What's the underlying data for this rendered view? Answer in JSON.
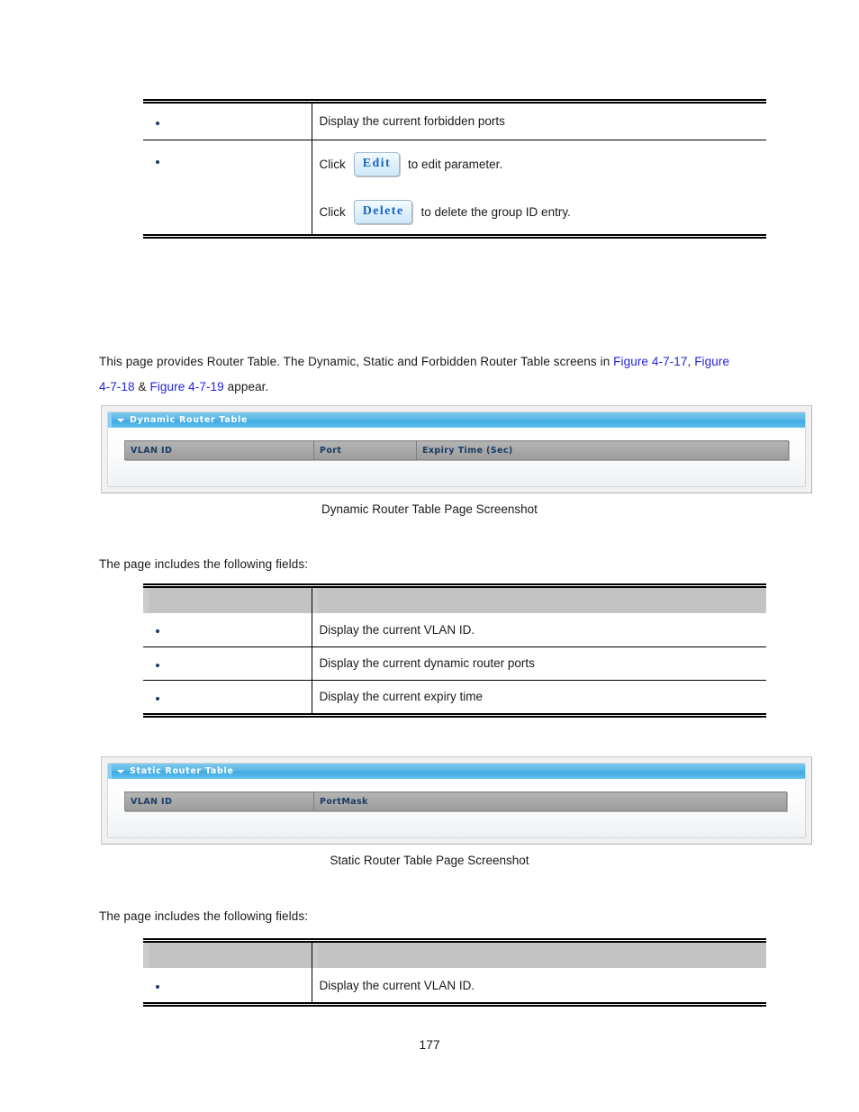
{
  "page": {
    "number": "177"
  },
  "top_table": {
    "rows": [
      {
        "bullet": "•",
        "description": "Display the current forbidden ports"
      }
    ],
    "action_row": {
      "bullet": "•",
      "edit_prefix": "Click",
      "edit_button_label": "Edit",
      "edit_suffix": "to edit parameter.",
      "delete_prefix": "Click",
      "delete_button_label": "Delete",
      "delete_suffix": "to delete the group ID entry."
    }
  },
  "intro": {
    "line1_a": "This page provides Router Table. The Dynamic, Static and Forbidden Router Table screens in ",
    "link1": "Figure 4-7-17",
    "line1_b": ", ",
    "link2_part1": "Figure",
    "link2_part2": "4-7-18",
    "line2_amp": " & ",
    "link3": "Figure 4-7-19",
    "line2_tail": " appear."
  },
  "dynamic_panel": {
    "title": "Dynamic Router Table",
    "columns": [
      "VLAN ID",
      "Port",
      "Expiry Time (Sec)"
    ],
    "rows": [],
    "caption": "Dynamic Router Table Page Screenshot"
  },
  "dynamic_fields": {
    "intro": "The page includes the following fields:",
    "header": [
      "",
      ""
    ],
    "rows": [
      {
        "bullet": "•",
        "description": "Display the current VLAN ID."
      },
      {
        "bullet": "•",
        "description": "Display the current dynamic router ports"
      },
      {
        "bullet": "•",
        "description": "Display the current expiry time"
      }
    ]
  },
  "static_panel": {
    "title": "Static Router Table",
    "columns": [
      "VLAN ID",
      "PortMask"
    ],
    "rows": [],
    "caption": "Static Router Table Page Screenshot"
  },
  "static_fields": {
    "intro": "The page includes the following fields:",
    "header": [
      "",
      ""
    ],
    "rows": [
      {
        "bullet": "•",
        "description": "Display the current VLAN ID."
      }
    ]
  },
  "colors": {
    "link": "#2222dd",
    "panel_title_blue": "#3fa9e0",
    "ui_table_header_gray": "#a5a5a5",
    "ui_header_text": "#1a3c63",
    "button_text": "#1565c0"
  }
}
